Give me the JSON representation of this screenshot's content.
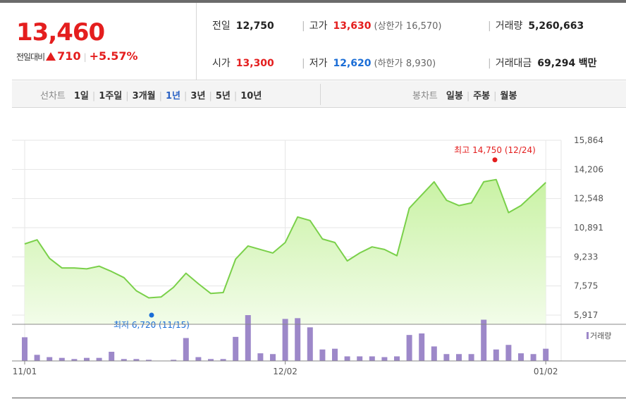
{
  "quote": {
    "price": "13,460",
    "change_label": "전일대비",
    "change_value": "710",
    "change_pct": "+5.57%"
  },
  "stats": {
    "prev_close": {
      "label": "전일",
      "value": "12,750"
    },
    "open": {
      "label": "시가",
      "value": "13,300"
    },
    "high": {
      "label": "고가",
      "value": "13,630",
      "limit_label": "(상한가",
      "limit_value": "16,570)"
    },
    "low": {
      "label": "저가",
      "value": "12,620",
      "limit_label": "(하한가",
      "limit_value": "8,930)"
    },
    "volume": {
      "label": "거래량",
      "value": "5,260,663"
    },
    "amount": {
      "label": "거래대금",
      "value": "69,294",
      "unit": "백만"
    }
  },
  "line_chart_tabs": {
    "title": "선차트",
    "items": [
      "1일",
      "1주일",
      "3개월",
      "1년",
      "3년",
      "5년",
      "10년"
    ],
    "active": "1년"
  },
  "candle_chart_tabs": {
    "title": "봉차트",
    "items": [
      "일봉",
      "주봉",
      "월봉"
    ]
  },
  "colors": {
    "up": "#e41e1e",
    "down": "#1a6dd6",
    "line": "#7ad04a",
    "area_top": "#c9f2a4",
    "area_bottom": "#f2fce9",
    "volume_bar": "#9d88c9",
    "active_tab": "#2b62c4"
  },
  "chart_data": {
    "type": "area",
    "y_ticks": [
      "15,864",
      "14,206",
      "12,548",
      "10,891",
      "9,233",
      "7,575",
      "5,917"
    ],
    "ylim": [
      5917,
      15864
    ],
    "x_ticks": [
      {
        "label": "11/01",
        "index": 1
      },
      {
        "label": "12/02",
        "index": 22
      },
      {
        "label": "01/02",
        "index": 43
      }
    ],
    "price": [
      9970,
      10200,
      9150,
      8600,
      8600,
      8550,
      8700,
      8400,
      8050,
      7300,
      6900,
      6950,
      7500,
      8300,
      7700,
      7150,
      7200,
      9100,
      9850,
      9650,
      9450,
      10050,
      11500,
      11300,
      10250,
      10050,
      9000,
      9450,
      9800,
      9650,
      9300,
      12000,
      12750,
      13500,
      12450,
      12150,
      12300,
      13500,
      13630,
      11750,
      12150,
      12800,
      13460
    ],
    "volume": [
      62,
      16,
      10,
      8,
      5,
      8,
      8,
      24,
      5,
      5,
      3,
      0,
      3,
      60,
      10,
      5,
      5,
      63,
      120,
      20,
      18,
      110,
      112,
      88,
      30,
      32,
      12,
      12,
      12,
      10,
      12,
      68,
      72,
      38,
      18,
      18,
      18,
      108,
      30,
      42,
      20,
      18,
      32
    ],
    "volume_legend": "거래량",
    "annotations": {
      "high": {
        "label": "최고",
        "value": "14,750",
        "date": "(12/24)"
      },
      "low": {
        "label": "최저",
        "value": "6,720",
        "date": "(11/15)"
      }
    }
  }
}
